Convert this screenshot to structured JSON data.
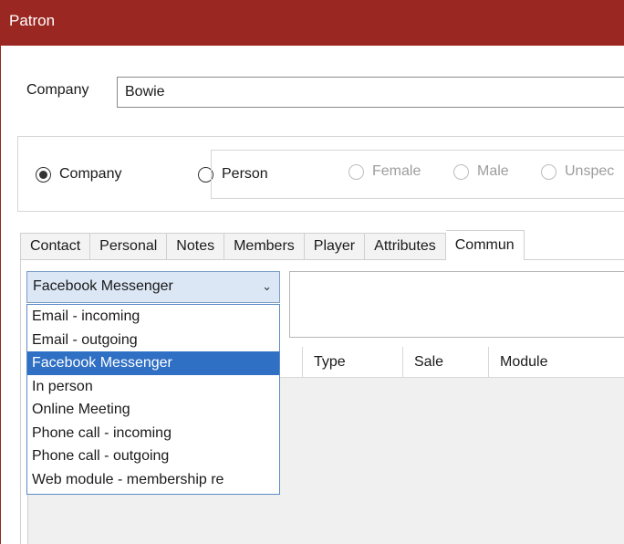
{
  "window": {
    "title": "Patron"
  },
  "company": {
    "label": "Company",
    "value": "Bowie"
  },
  "patron_type": {
    "company_label": "Company",
    "person_label": "Person",
    "gender_options": [
      "Female",
      "Male",
      "Unspec"
    ]
  },
  "tabs": [
    "Contact",
    "Personal",
    "Notes",
    "Members",
    "Player",
    "Attributes",
    "Commun"
  ],
  "communication": {
    "selected_type": "Facebook Messenger",
    "options": [
      "Email - incoming",
      "Email - outgoing",
      "Facebook Messenger",
      "In person",
      "Online Meeting",
      "Phone call - incoming",
      "Phone call - outgoing",
      "Web module - membership re"
    ],
    "grid_columns": [
      "Type",
      "Sale",
      "Module"
    ]
  },
  "icons": {
    "dropdown_arrow": "chevron-down-icon"
  },
  "colors": {
    "titlebar": "#9a2721",
    "selection": "#2f6fc4"
  }
}
